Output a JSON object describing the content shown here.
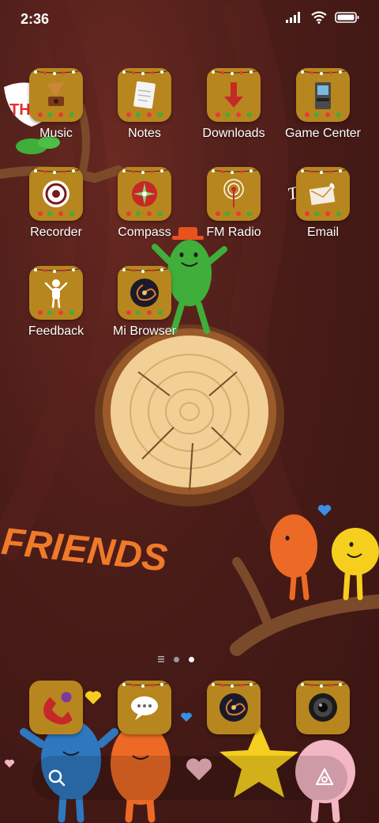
{
  "status": {
    "time": "2:36"
  },
  "apps": [
    {
      "label": "Music"
    },
    {
      "label": "Notes"
    },
    {
      "label": "Downloads"
    },
    {
      "label": "Game Center"
    },
    {
      "label": "Recorder"
    },
    {
      "label": "Compass"
    },
    {
      "label": "FM Radio"
    },
    {
      "label": "Email"
    },
    {
      "label": "Feedback"
    },
    {
      "label": "Mi Browser"
    }
  ],
  "wallpaper": {
    "friends_text": "FRIENDS",
    "sign_left": "TH",
    "sign_right": "T    s!"
  },
  "page_indicator": {
    "pages": 2,
    "current": 2
  },
  "colors": {
    "tile": "#b8861e",
    "background": "#4a1c18",
    "friends_orange": "#f07a2a"
  }
}
